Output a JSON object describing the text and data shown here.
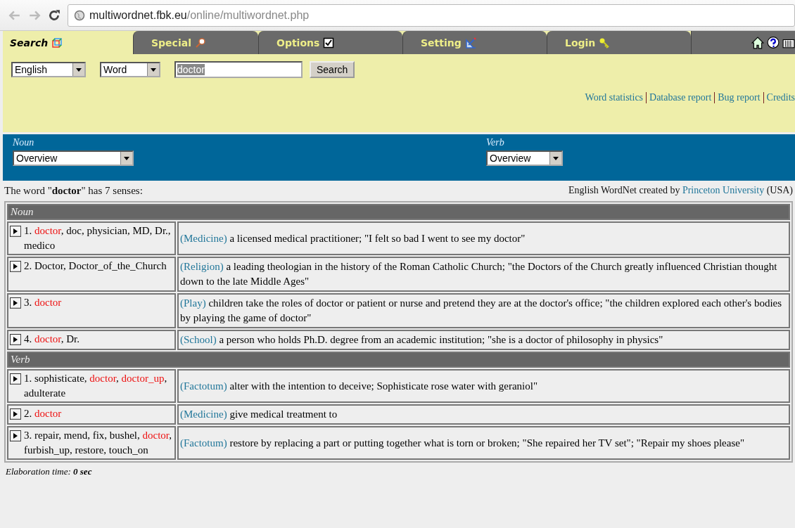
{
  "browser": {
    "url_host": "multiwordnet.fbk.eu",
    "url_path": "/online/multiwordnet.php"
  },
  "tabs": [
    {
      "label": "Search",
      "selected": true
    },
    {
      "label": "Special",
      "selected": false
    },
    {
      "label": "Options",
      "selected": false
    },
    {
      "label": "Setting",
      "selected": false
    },
    {
      "label": "Login",
      "selected": false
    }
  ],
  "search_form": {
    "language": "English",
    "type": "Word",
    "query": "doctor",
    "button": "Search"
  },
  "links": [
    "Word statistics",
    "Database report",
    "Bug report",
    "Credits"
  ],
  "pos_selectors": [
    {
      "label": "Noun",
      "value": "Overview"
    },
    {
      "label": "Verb",
      "value": "Overview"
    }
  ],
  "summary": {
    "before": "The word \"",
    "word": "doctor",
    "after": "\" has 7 senses:"
  },
  "credit": {
    "before": "English WordNet created by ",
    "link": "Princeton University",
    "after": " (USA)"
  },
  "sections": [
    {
      "title": "Noun",
      "senses": [
        {
          "synonyms": [
            {
              "text": "1. ",
              "highlighted": false
            },
            {
              "text": "doctor",
              "highlighted": true
            },
            {
              "text": ", doc, physician, MD, Dr., medico",
              "highlighted": false
            }
          ],
          "domain": "(Medicine)",
          "gloss": "a licensed medical practitioner; \"I felt so bad I went to see my doctor\""
        },
        {
          "synonyms": [
            {
              "text": "2. Doctor, Doctor_of_the_Church",
              "highlighted": false
            }
          ],
          "domain": "(Religion)",
          "gloss": "a leading theologian in the history of the Roman Catholic Church; \"the Doctors of the Church greatly influenced Christian thought down to the late Middle Ages\""
        },
        {
          "synonyms": [
            {
              "text": "3. ",
              "highlighted": false
            },
            {
              "text": "doctor",
              "highlighted": true
            }
          ],
          "domain": "(Play)",
          "gloss": "children take the roles of doctor or patient or nurse and pretend they are at the doctor's office; \"the children explored each other's bodies by playing the game of doctor\""
        },
        {
          "synonyms": [
            {
              "text": "4. ",
              "highlighted": false
            },
            {
              "text": "doctor",
              "highlighted": true
            },
            {
              "text": ", Dr.",
              "highlighted": false
            }
          ],
          "domain": "(School)",
          "gloss": "a person who holds Ph.D. degree from an academic institution; \"she is a doctor of philosophy in physics\""
        }
      ]
    },
    {
      "title": "Verb",
      "senses": [
        {
          "synonyms": [
            {
              "text": "1. sophisticate, ",
              "highlighted": false
            },
            {
              "text": "doctor",
              "highlighted": true
            },
            {
              "text": ", ",
              "highlighted": false
            },
            {
              "text": "doctor_up",
              "highlighted": true
            },
            {
              "text": ", adulterate",
              "highlighted": false
            }
          ],
          "domain": "(Factotum)",
          "gloss": "alter with the intention to deceive; Sophisticate rose water with geraniol\""
        },
        {
          "synonyms": [
            {
              "text": "2. ",
              "highlighted": false
            },
            {
              "text": "doctor",
              "highlighted": true
            }
          ],
          "domain": "(Medicine)",
          "gloss": "give medical treatment to"
        },
        {
          "synonyms": [
            {
              "text": "3. repair, mend, fix, bushel, ",
              "highlighted": false
            },
            {
              "text": "doctor",
              "highlighted": true
            },
            {
              "text": ", furbish_up, restore, touch_on",
              "highlighted": false
            }
          ],
          "domain": "(Factotum)",
          "gloss": "restore by replacing a part or putting together what is torn or broken; \"She repaired her TV set\"; \"Repair my shoes please\""
        }
      ]
    }
  ],
  "footer": {
    "label": "Elaboration time: ",
    "value": "0 sec"
  }
}
